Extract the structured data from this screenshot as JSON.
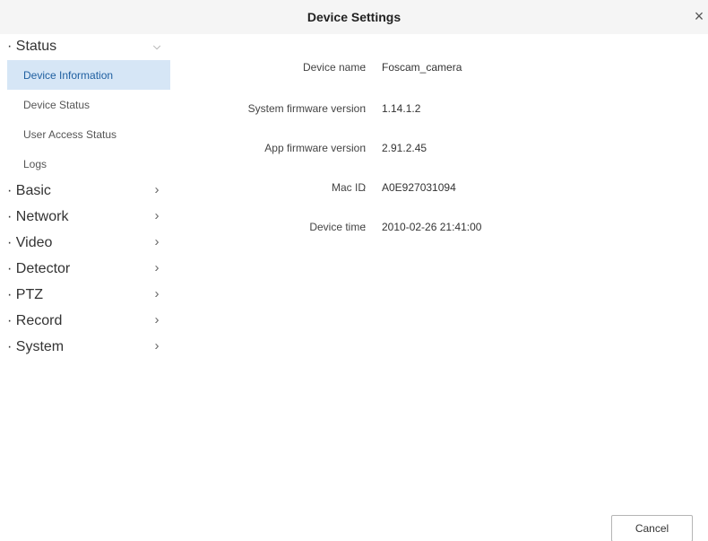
{
  "window": {
    "title": "Device Settings",
    "close_glyph": "×"
  },
  "sidebar": {
    "groups": [
      {
        "label": "· Status",
        "chevron": "⌵",
        "expanded": true,
        "items": [
          {
            "label": "Device Information",
            "active": true
          },
          {
            "label": "Device Status",
            "active": false
          },
          {
            "label": "User Access Status",
            "active": false
          },
          {
            "label": "Logs",
            "active": false
          }
        ]
      },
      {
        "label": "· Basic",
        "chevron": "›"
      },
      {
        "label": "· Network",
        "chevron": "›"
      },
      {
        "label": "· Video",
        "chevron": "›"
      },
      {
        "label": "· Detector",
        "chevron": "›"
      },
      {
        "label": "· PTZ",
        "chevron": "›"
      },
      {
        "label": "· Record",
        "chevron": "›"
      },
      {
        "label": "· System",
        "chevron": "›"
      }
    ]
  },
  "device_info": {
    "separator": ":",
    "rows": [
      {
        "key": "Device name",
        "value": "Foscam_camera"
      },
      {
        "key": "System firmware version",
        "value": "1.14.1.2"
      },
      {
        "key": "App firmware version",
        "value": "2.91.2.45"
      },
      {
        "key": "Mac ID",
        "value": "A0E927031094"
      },
      {
        "key": "Device time",
        "value": "2010-02-26 21:41:00"
      }
    ]
  },
  "footer": {
    "cancel_label": "Cancel"
  },
  "colors": {
    "active_item_bg": "#d6e6f6",
    "active_item_text": "#1f5fa0",
    "titlebar_bg": "#f5f5f5"
  }
}
